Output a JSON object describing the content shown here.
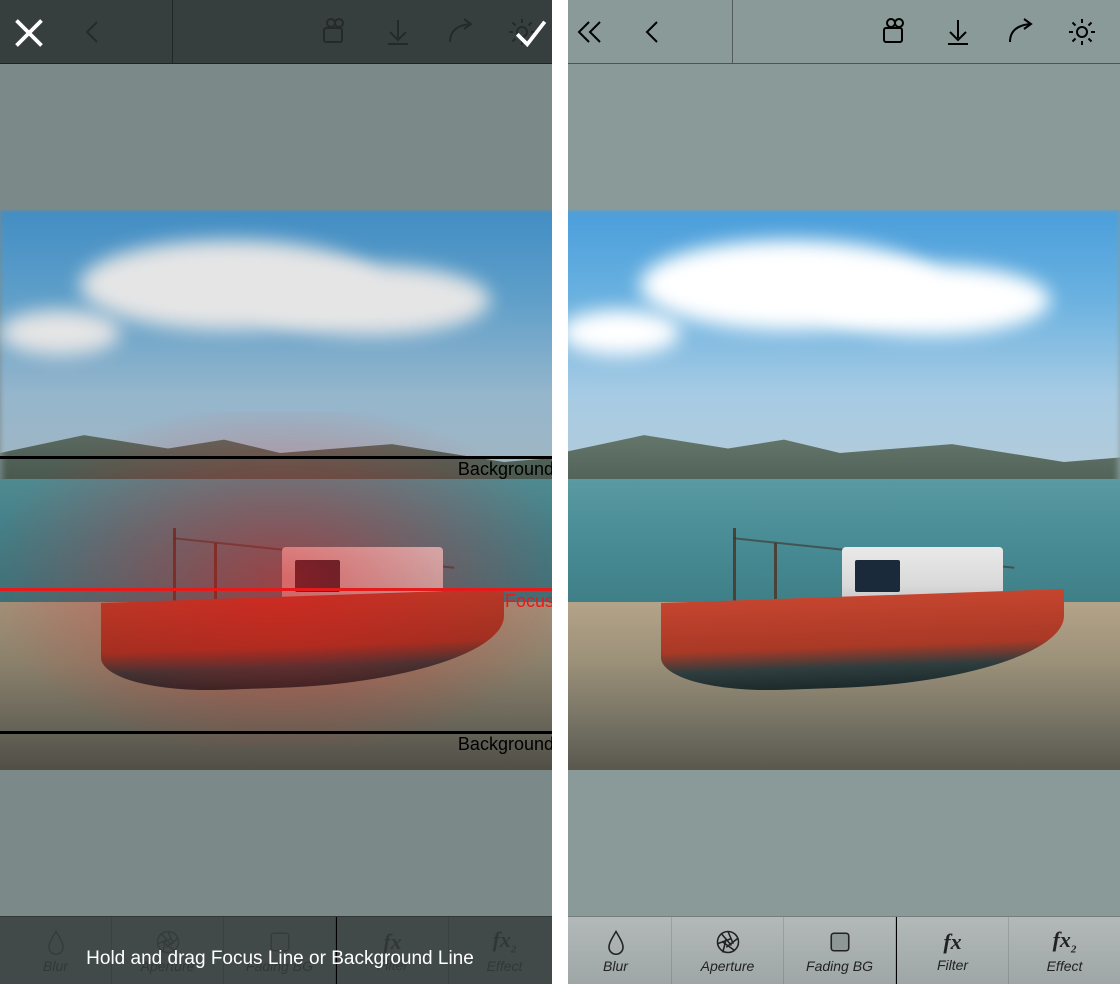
{
  "left": {
    "topbar": {
      "icons": [
        "back",
        "camcorder",
        "download",
        "share",
        "settings"
      ]
    },
    "overlay": {
      "close": "close",
      "confirm": "check"
    },
    "edit": {
      "background_label_top": "Background",
      "background_label_bottom": "Background",
      "focus_label": "Focus",
      "hint": "Hold and drag Focus Line or Background Line"
    },
    "toolbar": [
      {
        "label": "Blur",
        "icon": "drop"
      },
      {
        "label": "Aperture",
        "icon": "aperture"
      },
      {
        "label": "Fading BG",
        "icon": "square"
      },
      {
        "label": "Filter",
        "icon": "fx"
      },
      {
        "label": "Effect",
        "icon": "fx2"
      }
    ]
  },
  "right": {
    "topbar": {
      "icons": [
        "double-back",
        "back",
        "camcorder",
        "download",
        "share",
        "settings"
      ]
    },
    "toolbar": [
      {
        "label": "Blur",
        "icon": "drop"
      },
      {
        "label": "Aperture",
        "icon": "aperture"
      },
      {
        "label": "Fading BG",
        "icon": "square"
      },
      {
        "label": "Filter",
        "icon": "fx"
      },
      {
        "label": "Effect",
        "icon": "fx2"
      }
    ]
  }
}
